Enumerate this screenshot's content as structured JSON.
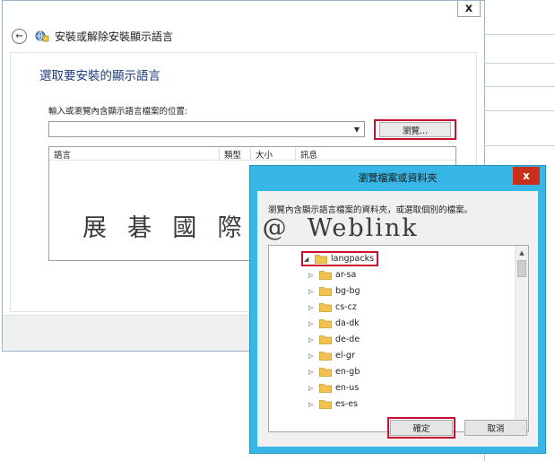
{
  "main_window": {
    "close_label": "x",
    "back_label": "←",
    "title": "安裝或解除安裝顯示語言",
    "heading": "選取要安裝的顯示語言",
    "path_label": "輸入或瀏覽內含顯示語言檔案的位置:",
    "path_value": "",
    "browse_label": "瀏覽...",
    "table": {
      "columns": [
        "語言",
        "類型",
        "大小",
        "訊息"
      ]
    }
  },
  "watermark": "展  碁  國  際  @  Weblink",
  "dialog": {
    "title": "瀏覽檔案或資料夾",
    "close_label": "x",
    "description": "瀏覽內含顯示語言檔案的資料夾，或選取個別的檔案。",
    "root_folder": "langpacks",
    "folders": [
      "ar-sa",
      "bg-bg",
      "cs-cz",
      "da-dk",
      "de-de",
      "el-gr",
      "en-gb",
      "en-us",
      "es-es"
    ],
    "ok_label": "確定",
    "cancel_label": "取消"
  },
  "colors": {
    "dialog_frame": "#38b7e6",
    "close_red": "#c7311c",
    "highlight_red": "#c8102e",
    "heading_blue": "#1e3c7a"
  }
}
